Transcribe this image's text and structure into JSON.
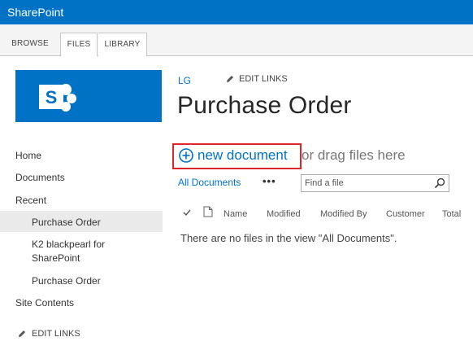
{
  "suite_bar": {
    "title": "SharePoint"
  },
  "ribbon": {
    "tabs": [
      "BROWSE",
      "FILES",
      "LIBRARY"
    ]
  },
  "logo": {
    "letter": "S"
  },
  "header": {
    "site_link": "LG",
    "edit_links": "EDIT LINKS",
    "page_title": "Purchase Order"
  },
  "left_nav": {
    "items": [
      {
        "label": "Home"
      },
      {
        "label": "Documents"
      },
      {
        "label": "Recent"
      },
      {
        "label": "Purchase Order"
      },
      {
        "label": "K2 blackpearl for"
      },
      {
        "label": "SharePoint"
      },
      {
        "label": "Purchase Order"
      },
      {
        "label": "Site Contents"
      }
    ],
    "edit_links": "EDIT LINKS"
  },
  "toolbar": {
    "new_document": "new document",
    "drag_text": "or drag files here",
    "view_name": "All Documents",
    "more": "•••",
    "search_placeholder": "Find a file"
  },
  "list": {
    "columns": [
      "Name",
      "Modified",
      "Modified By",
      "Customer",
      "Total"
    ],
    "empty_message": "There are no files in the view \"All Documents\"."
  },
  "colors": {
    "brand": "#0072c6",
    "highlight": "#e0262b"
  }
}
